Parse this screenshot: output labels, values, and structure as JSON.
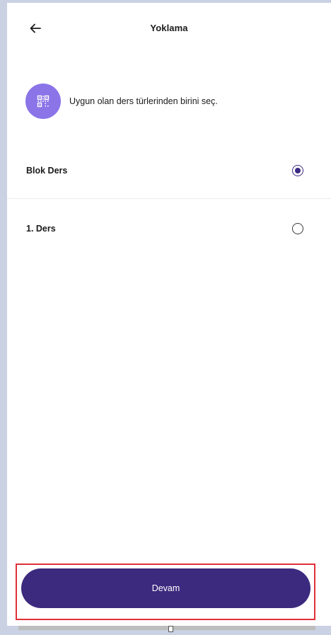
{
  "header": {
    "title": "Yoklama",
    "back_icon": "arrow-left-icon"
  },
  "info": {
    "icon": "qr-code-icon",
    "text": "Uygun olan ders türlerinden birini seç."
  },
  "options": [
    {
      "label": "Blok Ders",
      "selected": true
    },
    {
      "label": "1. Ders",
      "selected": false
    }
  ],
  "cta": {
    "label": "Devam"
  },
  "colors": {
    "accent": "#3b2a7e",
    "icon_bg": "#8b74e8",
    "highlight": "#e0303a"
  }
}
